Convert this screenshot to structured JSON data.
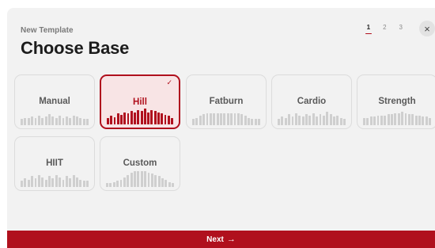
{
  "header": {
    "subtitle": "New Template",
    "title": "Choose Base",
    "steps": [
      "1",
      "2",
      "3"
    ],
    "active_step": 0,
    "close_icon": "×"
  },
  "cards": [
    {
      "label": "Manual",
      "selected": false,
      "profile": [
        5,
        6,
        6,
        7,
        6,
        8,
        6,
        7,
        9,
        7,
        6,
        8,
        6,
        7,
        6,
        8,
        7,
        6,
        5,
        5
      ]
    },
    {
      "label": "Hill",
      "selected": true,
      "check": "✓",
      "profile": [
        5,
        7,
        6,
        9,
        8,
        10,
        9,
        11,
        10,
        12,
        11,
        13,
        10,
        12,
        11,
        10,
        9,
        8,
        7,
        5
      ]
    },
    {
      "label": "Fatburn",
      "selected": false,
      "profile": [
        5,
        6,
        8,
        9,
        10,
        10,
        10,
        10,
        10,
        10,
        10,
        10,
        10,
        10,
        9,
        8,
        6,
        5,
        5,
        5
      ]
    },
    {
      "label": "Cardio",
      "selected": false,
      "profile": [
        5,
        7,
        6,
        9,
        7,
        10,
        8,
        7,
        9,
        8,
        10,
        7,
        9,
        8,
        11,
        9,
        7,
        8,
        6,
        5
      ]
    },
    {
      "label": "Strength",
      "selected": false,
      "profile": [
        6,
        6,
        7,
        7,
        8,
        8,
        8,
        9,
        9,
        10,
        10,
        11,
        10,
        9,
        9,
        8,
        8,
        7,
        7,
        6
      ]
    },
    {
      "label": "HIIT",
      "selected": false,
      "profile": [
        5,
        7,
        6,
        9,
        7,
        10,
        8,
        6,
        9,
        7,
        10,
        8,
        6,
        9,
        7,
        10,
        8,
        6,
        5,
        5
      ]
    },
    {
      "label": "Custom",
      "selected": false,
      "profile": [
        3,
        3,
        4,
        5,
        6,
        8,
        10,
        12,
        13,
        13,
        13,
        13,
        12,
        11,
        10,
        9,
        7,
        6,
        4,
        3
      ]
    }
  ],
  "footer": {
    "next_label": "Next",
    "arrow_icon": "→"
  }
}
